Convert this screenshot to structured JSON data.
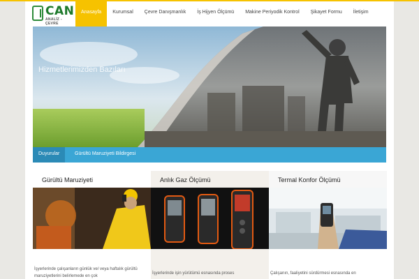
{
  "brand": {
    "name": "CAN",
    "subtitle": "ANALİZ - ÇEVRE"
  },
  "nav": {
    "items": [
      {
        "label": "Anasayfa",
        "active": true
      },
      {
        "label": "Kurumsal"
      },
      {
        "label": "Çevre Danışmanlık"
      },
      {
        "label": "İş Hijyen Ölçümü"
      },
      {
        "label": "Makine Periyodik Kontrol"
      },
      {
        "label": "Şikayet Formu"
      },
      {
        "label": "İletişim"
      }
    ]
  },
  "hero": {
    "caption": "Hizmetlerimizden Bazıları"
  },
  "news": {
    "label": "Duyurular",
    "text": "Gürültü Maruziyeti Bildirgesi"
  },
  "cards": [
    {
      "title": "Gürültü Maruziyeti",
      "desc": "İşyerlerinde çalışanların günlük ve/ veya haftalık gürültü maruziyetlerini belirlemede en çok"
    },
    {
      "title": "Anlık Gaz Ölçümü",
      "desc": "İşyerlerinde işin yürütümü esnasında proses"
    },
    {
      "title": "Termal Konfor Ölçümü",
      "desc": "Çalışanın, faaliyetini sürdürmesi esnasında en"
    }
  ],
  "colors": {
    "accent": "#f6c200",
    "news_bar": "#3aa6d5",
    "news_label": "#2b8ab6",
    "brand_green": "#1f7a2c"
  }
}
